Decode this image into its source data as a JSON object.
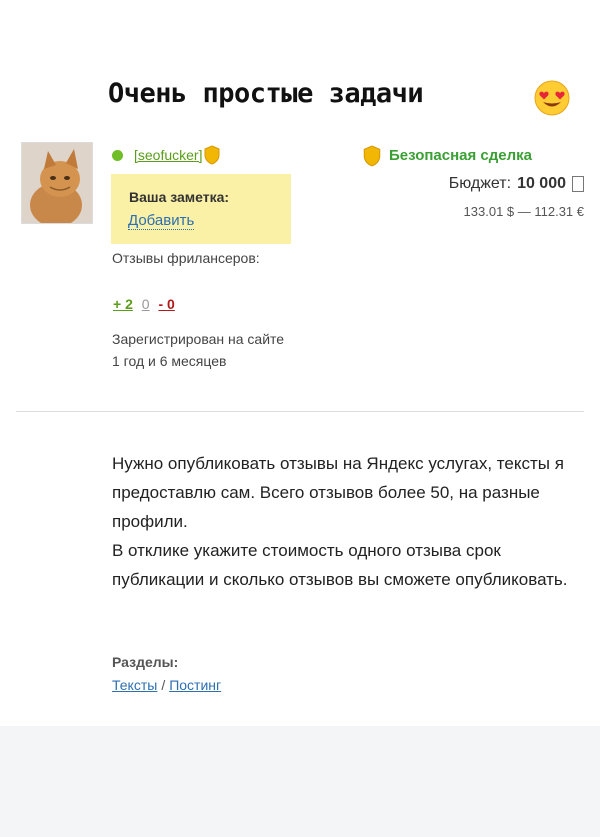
{
  "headline": "Очень простые задачи",
  "colors": {
    "online": "#6fbd27",
    "username": "#5a9e1a",
    "safe_deal": "#3aa033",
    "note_bg": "#faf0a6",
    "link": "#2c6fb3",
    "negative": "#b41a1a"
  },
  "icons": {
    "emoji": "smiling-face-with-heart-eyes-icon",
    "shield": "shield-icon",
    "online": "online-dot-icon",
    "currency": "ruble-placeholder-icon"
  },
  "user": {
    "username": "[seofucker]",
    "note_title": "Ваша заметка:",
    "note_add": "Добавить",
    "reviews_label": "Отзывы фрилансеров:",
    "reviews": {
      "positive": "+ 2",
      "neutral": "0",
      "negative": "- 0"
    },
    "registered_label": "Зарегистрирован на сайте",
    "registered_period": "1 год и 6 месяцев"
  },
  "deal": {
    "safe_deal_label": "Безопасная сделка",
    "budget_label": "Бюджет:",
    "budget_value": "10 000",
    "budget_conversion": "133.01 $ — 112.31 €"
  },
  "description": {
    "paragraph1": "Нужно опубликовать отзывы на Яндекс услугах, тексты я предоставлю сам. Всего отзывов более 50, на разные профили.",
    "paragraph2": "В отклике укажите стоимость одного отзыва срок публикации и сколько отзывов вы сможете опубликовать."
  },
  "sections": {
    "label": "Разделы:",
    "links": [
      "Тексты",
      "Постинг"
    ],
    "separator": "/"
  }
}
